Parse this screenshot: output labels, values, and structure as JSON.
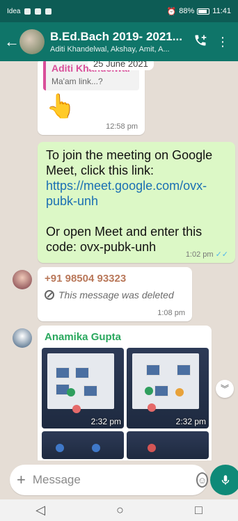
{
  "status_bar": {
    "carrier": "Idea",
    "battery": "88%",
    "time": "11:41"
  },
  "header": {
    "title": "B.Ed.Bach 2019- 2021...",
    "subtitle": "Aditi Khandelwal, Akshay, Amit, A...",
    "back_icon": "arrow-left-icon",
    "call_icon": "add-call-icon",
    "menu_icon": "more-vertical-icon"
  },
  "date_pill": "25 June 2021",
  "messages": [
    {
      "type": "incoming-reply",
      "quoted_name": "Aditi Khandelwal",
      "quoted_text": "Ma'am link...?",
      "emoji": "👆",
      "time": "12:58 pm"
    },
    {
      "type": "outgoing",
      "text_before": "To join the meeting on Google Meet, click this link:",
      "link": "https://meet.google.com/ovx-pubk-unh",
      "text_after": "Or open Meet and enter this code: ovx-pubk-unh",
      "time": "1:02 pm",
      "ticks": "✓✓"
    },
    {
      "type": "incoming-deleted",
      "sender": "+91 98504 93323",
      "text": "This message was deleted",
      "time": "1:08 pm"
    },
    {
      "type": "incoming-images",
      "sender": "Anamika Gupta",
      "image_times": [
        "2:32 pm",
        "2:32 pm"
      ]
    }
  ],
  "composer": {
    "placeholder": "Message"
  },
  "colors": {
    "header": "#0f7569",
    "status": "#0d5c55",
    "outgoing": "#dcf8c6",
    "link": "#1a6fb3",
    "quote_accent": "#d94f9a",
    "sender_phone": "#b9785a",
    "sender_anamika": "#2aa85e"
  }
}
